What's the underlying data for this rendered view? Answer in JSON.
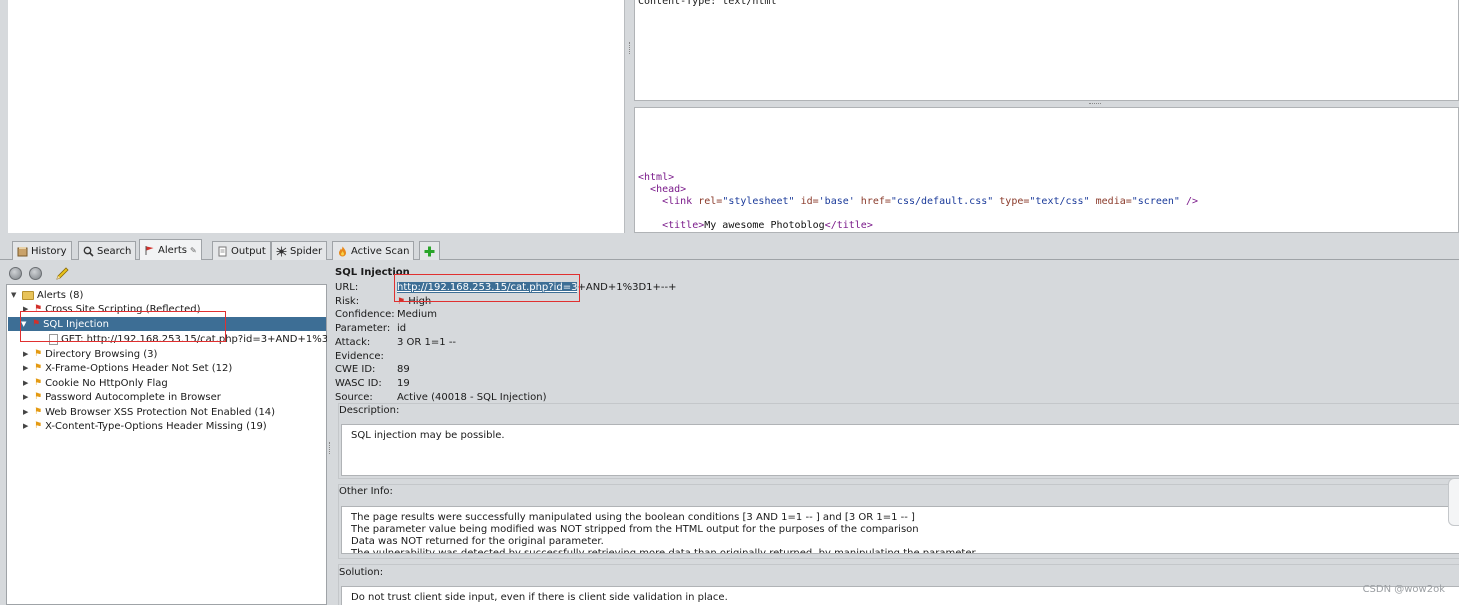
{
  "response": {
    "header_text": "Content-Type: text/html",
    "body_lines": [
      {
        "parts": [
          [
            "tag",
            "<html>"
          ]
        ]
      },
      {
        "parts": [
          [
            "txt",
            "  "
          ],
          [
            "tag",
            "<head>"
          ]
        ]
      },
      {
        "parts": [
          [
            "txt",
            "    "
          ],
          [
            "tag",
            "<link "
          ],
          [
            "attr",
            "rel="
          ],
          [
            "val",
            "\"stylesheet\""
          ],
          [
            "attr",
            " id="
          ],
          [
            "val",
            "'base'"
          ],
          [
            "attr",
            " href="
          ],
          [
            "val",
            "\"css/default.css\""
          ],
          [
            "attr",
            " type="
          ],
          [
            "val",
            "\"text/css\""
          ],
          [
            "attr",
            " media="
          ],
          [
            "val",
            "\"screen\""
          ],
          [
            "tag",
            " />"
          ]
        ]
      },
      {
        "parts": [
          [
            "txt",
            " "
          ]
        ]
      },
      {
        "parts": [
          [
            "txt",
            "    "
          ],
          [
            "tag",
            "<title>"
          ],
          [
            "txt",
            "My awesome Photoblog"
          ],
          [
            "tag",
            "</title>"
          ]
        ]
      }
    ]
  },
  "tabs": [
    {
      "label": "History",
      "icon": "history-icon"
    },
    {
      "label": "Search",
      "icon": "search-icon"
    },
    {
      "label": "Alerts",
      "icon": "alert-flag-icon",
      "pin": "📌"
    },
    {
      "label": "Output",
      "icon": "output-icon"
    },
    {
      "label": "Spider",
      "icon": "spider-icon"
    },
    {
      "label": "Active Scan",
      "icon": "flame-icon"
    },
    {
      "label": "",
      "icon": "plus-icon"
    }
  ],
  "tree": {
    "root": "Alerts (8)",
    "items": [
      {
        "label": "Cross Site Scripting (Reflected)",
        "flag": "red",
        "expanded": false
      },
      {
        "label": "SQL Injection",
        "flag": "red",
        "expanded": true,
        "selected": true
      },
      {
        "label": "GET: http://192.168.253.15/cat.php?id=3+AND+1%3",
        "child": true
      },
      {
        "label": "Directory Browsing (3)",
        "flag": "orange",
        "expanded": false
      },
      {
        "label": "X-Frame-Options Header Not Set (12)",
        "flag": "orange",
        "expanded": false
      },
      {
        "label": "Cookie No HttpOnly Flag",
        "flag": "orange",
        "expanded": false
      },
      {
        "label": "Password Autocomplete in Browser",
        "flag": "orange",
        "expanded": false
      },
      {
        "label": "Web Browser XSS Protection Not Enabled (14)",
        "flag": "orange",
        "expanded": false
      },
      {
        "label": "X-Content-Type-Options Header Missing (19)",
        "flag": "orange",
        "expanded": false
      }
    ]
  },
  "detail": {
    "title": "SQL Injection",
    "url_label": "URL:",
    "url_highlight": "http://192.168.253.15/cat.php?id=3",
    "url_rest": "+AND+1%3D1+--+",
    "risk_label": "Risk:",
    "risk": "High",
    "confidence_label": "Confidence:",
    "confidence": "Medium",
    "parameter_label": "Parameter:",
    "parameter": "id",
    "attack_label": "Attack:",
    "attack": "3 OR 1=1 --",
    "evidence_label": "Evidence:",
    "evidence": "",
    "cwe_label": "CWE ID:",
    "cwe": "89",
    "wasc_label": "WASC ID:",
    "wasc": "19",
    "source_label": "Source:",
    "source": "Active (40018 - SQL Injection)",
    "description_label": "Description:",
    "description": "SQL injection may be possible.",
    "other_info_label": "Other Info:",
    "other_info": [
      "The page results were successfully manipulated using the boolean conditions [3 AND 1=1 -- ] and [3 OR 1=1 -- ]",
      "The parameter value being modified was NOT stripped from the HTML output for the purposes of the comparison",
      "Data was NOT returned for the original parameter.",
      "The vulnerability was detected by successfully retrieving more data than originally returned, by manipulating the parameter"
    ],
    "solution_label": "Solution:",
    "solution": "Do not trust client side input, even if there is client side validation in place."
  },
  "watermark": "CSDN @wow2ok"
}
